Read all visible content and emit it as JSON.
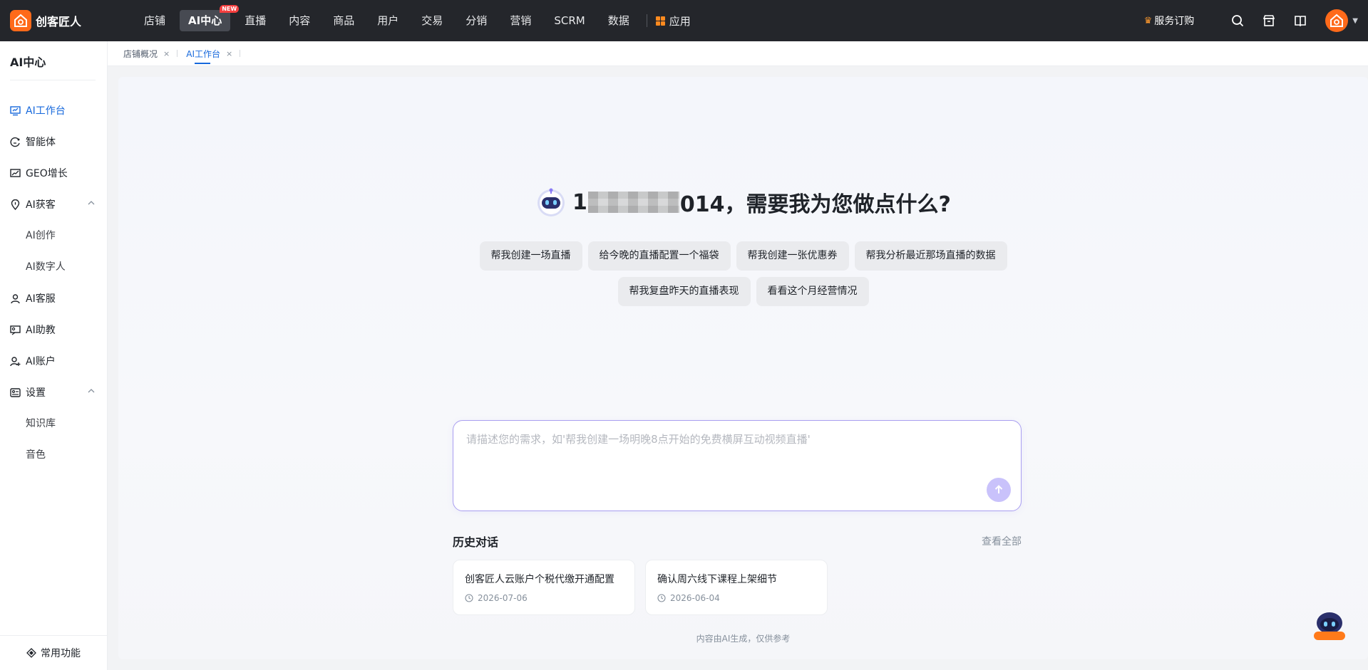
{
  "brand": {
    "name": "创客匠人"
  },
  "nav": {
    "items": [
      {
        "label": "店铺",
        "active": false
      },
      {
        "label": "AI中心",
        "active": true,
        "badge": "NEW"
      },
      {
        "label": "直播",
        "active": false
      },
      {
        "label": "内容",
        "active": false
      },
      {
        "label": "商品",
        "active": false
      },
      {
        "label": "用户",
        "active": false
      },
      {
        "label": "交易",
        "active": false
      },
      {
        "label": "分销",
        "active": false
      },
      {
        "label": "营销",
        "active": false
      },
      {
        "label": "SCRM",
        "active": false
      },
      {
        "label": "数据",
        "active": false
      }
    ],
    "apps_label": "应用"
  },
  "topright": {
    "subscribe_prefix": "服务",
    "subscribe_label": "订购",
    "icons": [
      "search-icon",
      "store-icon",
      "book-icon"
    ]
  },
  "sidebar": {
    "title": "AI中心",
    "items": [
      {
        "label": "AI工作台",
        "icon": "dashboard-icon",
        "active": true
      },
      {
        "label": "智能体",
        "icon": "agent-icon"
      },
      {
        "label": "GEO增长",
        "icon": "growth-chart-icon"
      },
      {
        "label": "AI获客",
        "icon": "location-pin-icon",
        "expanded": true,
        "children": [
          {
            "label": "AI创作"
          },
          {
            "label": "AI数字人"
          }
        ]
      },
      {
        "label": "AI客服",
        "icon": "user-icon"
      },
      {
        "label": "AI助教",
        "icon": "teacher-icon"
      },
      {
        "label": "AI账户",
        "icon": "user-plus-icon"
      },
      {
        "label": "设置",
        "icon": "settings-icon",
        "expanded": true,
        "children": [
          {
            "label": "知识库"
          },
          {
            "label": "音色"
          }
        ]
      }
    ],
    "bottom_label": "常用功能"
  },
  "tabs": [
    {
      "label": "店铺概况",
      "active": false
    },
    {
      "label": "AI工作台",
      "active": true
    }
  ],
  "main": {
    "greeting_prefix": "1",
    "greeting_suffix": "014，需要我为您做点什么?",
    "suggestions_row1": [
      "帮我创建一场直播",
      "给今晚的直播配置一个福袋",
      "帮我创建一张优惠券",
      "帮我分析最近那场直播的数据"
    ],
    "suggestions_row2": [
      "帮我复盘昨天的直播表现",
      "看看这个月经营情况"
    ],
    "input_placeholder": "请描述您的需求，如'帮我创建一场明晚8点开始的免费横屏互动视频直播'",
    "history_title": "历史对话",
    "history_view_all": "查看全部",
    "history": [
      {
        "title": "创客匠人云账户个税代缴开通配置",
        "date": "2026-07-06"
      },
      {
        "title": "确认周六线下课程上架细节",
        "date": "2026-06-04"
      }
    ],
    "disclaimer": "内容由AI生成，仅供参考"
  },
  "colors": {
    "accent": "#1668dc",
    "brand": "#ff6a1a",
    "topbar": "#24262b",
    "send": "#c9c2fb"
  }
}
